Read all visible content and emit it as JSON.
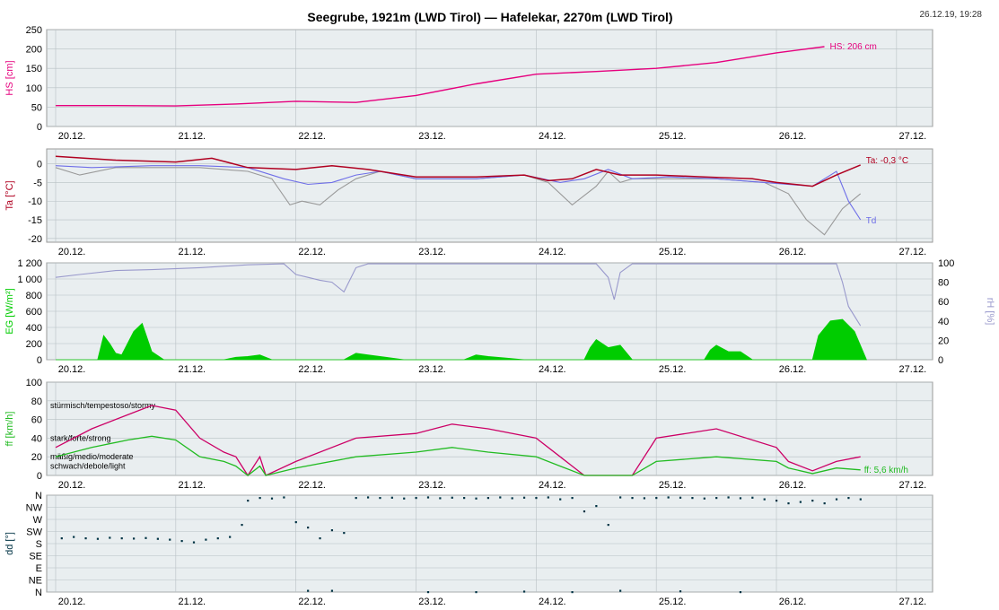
{
  "title": "Seegrube, 1921m (LWD Tirol) — Hafelekar, 2270m (LWD Tirol)",
  "timestamp": "26.12.19, 19:28",
  "colors": {
    "snow": "#e6007e",
    "temp": "#b00020",
    "dew": "#6e6ee8",
    "wetbulb": "#999999",
    "radiation": "#00cc00",
    "humidity": "#9999cc",
    "gust": "#cc0066",
    "wind": "#22bb22",
    "dir": "#003344",
    "panel_bg": "#e9eef0",
    "grid": "#b8c0c4"
  },
  "chart_data": [
    {
      "type": "line",
      "name": "snow-depth",
      "ylabel": "HS [cm]",
      "ylim": [
        0,
        250
      ],
      "yticks": [
        "0",
        "50",
        "100",
        "150",
        "200",
        "250"
      ],
      "x_labels": [
        "20.12.",
        "21.12.",
        "22.12.",
        "23.12.",
        "24.12.",
        "25.12.",
        "26.12.",
        "27.12."
      ],
      "end_label": "HS: 206 cm",
      "series": [
        {
          "name": "HS",
          "x": [
            0,
            0.5,
            1,
            1.5,
            2,
            2.5,
            3,
            3.5,
            4,
            4.5,
            5,
            5.5,
            6,
            6.4
          ],
          "y": [
            54,
            54,
            53,
            58,
            65,
            62,
            80,
            110,
            135,
            142,
            150,
            165,
            190,
            206
          ]
        }
      ]
    },
    {
      "type": "line",
      "name": "air-temperature",
      "ylabel": "Ta [°C]",
      "ylim": [
        -21,
        4
      ],
      "yticks": [
        "0",
        "-5",
        "-10",
        "-15",
        "-20"
      ],
      "x_labels": [
        "20.12.",
        "21.12.",
        "22.12.",
        "23.12.",
        "24.12.",
        "25.12.",
        "26.12.",
        "27.12."
      ],
      "end_label": "Ta: -0,3 °C",
      "dew_label": "Td",
      "series": [
        {
          "name": "Ta",
          "x": [
            0,
            0.5,
            1,
            1.3,
            1.6,
            2,
            2.3,
            2.6,
            3,
            3.5,
            3.9,
            4.1,
            4.3,
            4.5,
            4.7,
            5,
            5.4,
            5.8,
            6,
            6.3,
            6.5,
            6.7
          ],
          "y": [
            2,
            1,
            0.5,
            1.5,
            -1,
            -1.5,
            -0.5,
            -1.5,
            -3.5,
            -3.5,
            -3,
            -4.5,
            -4,
            -1.5,
            -3,
            -3,
            -3.5,
            -4,
            -5,
            -6,
            -3,
            -0.3
          ]
        },
        {
          "name": "Td",
          "x": [
            0,
            0.3,
            0.8,
            1.2,
            1.6,
            1.9,
            2.1,
            2.3,
            2.5,
            2.7,
            3,
            3.5,
            3.9,
            4.2,
            4.4,
            4.6,
            4.8,
            5.1,
            5.5,
            5.9,
            6.3,
            6.5,
            6.6,
            6.7
          ],
          "y": [
            -0.5,
            -1,
            -0.5,
            -0.5,
            -1,
            -4,
            -5.5,
            -5,
            -3,
            -2,
            -4,
            -4,
            -3,
            -5,
            -4,
            -1.5,
            -4,
            -3.5,
            -4,
            -5,
            -6,
            -2,
            -10,
            -15
          ]
        },
        {
          "name": "Tw",
          "x": [
            0,
            0.2,
            0.5,
            0.8,
            1.2,
            1.6,
            1.8,
            1.95,
            2.05,
            2.2,
            2.35,
            2.5,
            2.7,
            3,
            3.5,
            3.9,
            4.1,
            4.3,
            4.5,
            4.6,
            4.7,
            4.8,
            5.1,
            5.5,
            5.9,
            6.1,
            6.25,
            6.4,
            6.55,
            6.7
          ],
          "y": [
            -1,
            -3,
            -1,
            -1,
            -1,
            -2,
            -4,
            -11,
            -10,
            -11,
            -7,
            -4,
            -2,
            -4,
            -4,
            -3,
            -5,
            -11,
            -6,
            -2,
            -5,
            -4,
            -4,
            -4,
            -5,
            -8,
            -15,
            -19,
            -12,
            -8
          ]
        }
      ]
    },
    {
      "type": "area",
      "name": "radiation-humidity",
      "ylabel": "EG [W/m²]",
      "ylabel_right": "rH [%]",
      "ylim": [
        0,
        1200
      ],
      "ylim_right": [
        0,
        100
      ],
      "yticks": [
        "0",
        "200",
        "400",
        "600",
        "800",
        "1 000",
        "1 200"
      ],
      "yticks_right": [
        "0",
        "20",
        "40",
        "60",
        "80",
        "100"
      ],
      "x_labels": [
        "20.12.",
        "21.12.",
        "22.12.",
        "23.12.",
        "24.12.",
        "25.12.",
        "26.12.",
        "27.12."
      ],
      "series": [
        {
          "name": "EG",
          "x": [
            0,
            0.35,
            0.4,
            0.45,
            0.5,
            0.55,
            0.65,
            0.72,
            0.8,
            0.9,
            1,
            1.4,
            1.5,
            1.6,
            1.7,
            1.8,
            2.4,
            2.5,
            2.6,
            2.75,
            2.9,
            3.4,
            3.5,
            3.6,
            3.75,
            3.9,
            4.4,
            4.45,
            4.5,
            4.6,
            4.7,
            4.8,
            5.4,
            5.45,
            5.5,
            5.6,
            5.7,
            5.8,
            6.3,
            6.35,
            6.45,
            6.55,
            6.65,
            6.75
          ],
          "y": [
            0,
            0,
            300,
            200,
            80,
            60,
            350,
            450,
            100,
            0,
            0,
            0,
            30,
            40,
            60,
            0,
            0,
            80,
            60,
            30,
            0,
            0,
            60,
            40,
            20,
            0,
            0,
            150,
            250,
            150,
            180,
            0,
            0,
            120,
            180,
            100,
            100,
            0,
            0,
            300,
            480,
            500,
            350,
            0
          ]
        },
        {
          "name": "rH",
          "x": [
            0,
            0.2,
            0.5,
            0.8,
            1.2,
            1.6,
            1.9,
            2.0,
            2.1,
            2.2,
            2.3,
            2.4,
            2.5,
            2.6,
            2.7,
            3,
            3.5,
            4,
            4.5,
            4.6,
            4.65,
            4.7,
            4.8,
            5,
            5.5,
            6,
            6.3,
            6.5,
            6.55,
            6.6,
            6.7
          ],
          "y": [
            85,
            88,
            92,
            93,
            95,
            98,
            99,
            88,
            85,
            82,
            80,
            70,
            95,
            99,
            99,
            99,
            99,
            99,
            99,
            85,
            62,
            90,
            99,
            99,
            99,
            99,
            99,
            99,
            80,
            55,
            35
          ]
        }
      ]
    },
    {
      "type": "line",
      "name": "wind-speed",
      "ylabel": "ff [km/h]",
      "ylim": [
        0,
        100
      ],
      "yticks": [
        "0",
        "20",
        "40",
        "60",
        "80",
        "100"
      ],
      "x_labels": [
        "20.12.",
        "21.12.",
        "22.12.",
        "23.12.",
        "24.12.",
        "25.12.",
        "26.12.",
        "27.12."
      ],
      "end_label": "ff: 5,6 km/h",
      "annotations": [
        "stürmisch/tempestoso/stormy",
        "stark/forte/strong",
        "mäßig/medio/moderate",
        "schwach/debole/light"
      ],
      "annotation_levels": [
        75,
        40,
        20,
        10
      ],
      "series": [
        {
          "name": "gust",
          "x": [
            0,
            0.3,
            0.6,
            0.8,
            1,
            1.2,
            1.4,
            1.5,
            1.6,
            1.7,
            1.75,
            2,
            2.5,
            3,
            3.3,
            3.6,
            4,
            4.2,
            4.4,
            4.5,
            4.8,
            5,
            5.5,
            6,
            6.1,
            6.3,
            6.5,
            6.7
          ],
          "y": [
            30,
            50,
            65,
            75,
            70,
            40,
            25,
            20,
            0,
            20,
            0,
            15,
            40,
            45,
            55,
            50,
            40,
            20,
            0,
            0,
            0,
            40,
            50,
            30,
            15,
            5,
            15,
            20
          ]
        },
        {
          "name": "wind",
          "x": [
            0,
            0.3,
            0.6,
            0.8,
            1,
            1.2,
            1.4,
            1.5,
            1.6,
            1.7,
            1.75,
            2,
            2.5,
            3,
            3.3,
            3.6,
            4,
            4.2,
            4.4,
            4.5,
            4.8,
            5,
            5.5,
            6,
            6.1,
            6.3,
            6.5,
            6.7
          ],
          "y": [
            20,
            30,
            38,
            42,
            38,
            20,
            15,
            10,
            0,
            10,
            0,
            8,
            20,
            25,
            30,
            25,
            20,
            10,
            0,
            0,
            0,
            15,
            20,
            15,
            8,
            2,
            8,
            6
          ]
        }
      ]
    },
    {
      "type": "scatter",
      "name": "wind-direction",
      "ylabel": "dd [°]",
      "ylim": [
        0,
        360
      ],
      "yticks": [
        "N",
        "NE",
        "E",
        "SE",
        "S",
        "SW",
        "W",
        "NW",
        "N"
      ],
      "x_labels": [
        "20.12.",
        "21.12.",
        "22.12.",
        "23.12.",
        "24.12.",
        "25.12.",
        "26.12.",
        "27.12."
      ],
      "series": [
        {
          "name": "dd",
          "x": [
            0.05,
            0.15,
            0.25,
            0.35,
            0.45,
            0.55,
            0.65,
            0.75,
            0.85,
            0.95,
            1.05,
            1.15,
            1.25,
            1.35,
            1.45,
            1.55,
            1.6,
            1.7,
            1.8,
            1.9,
            2.0,
            2.1,
            2.2,
            2.3,
            2.4,
            2.5,
            2.6,
            2.7,
            2.8,
            2.9,
            3.0,
            3.1,
            3.2,
            3.3,
            3.4,
            3.5,
            3.6,
            3.7,
            3.8,
            3.9,
            4.0,
            4.1,
            4.2,
            4.3,
            4.4,
            4.5,
            4.6,
            4.7,
            4.8,
            4.9,
            5.0,
            5.1,
            5.2,
            5.3,
            5.4,
            5.5,
            5.6,
            5.7,
            5.8,
            5.9,
            6.0,
            6.1,
            6.2,
            6.3,
            6.4,
            6.5,
            6.6,
            6.7,
            2.1,
            2.3,
            3.1,
            3.5,
            3.9,
            4.3,
            4.7,
            5.2,
            5.7
          ],
          "y": [
            200,
            205,
            200,
            198,
            202,
            200,
            199,
            201,
            198,
            195,
            190,
            185,
            195,
            200,
            205,
            250,
            340,
            350,
            348,
            352,
            260,
            240,
            200,
            230,
            220,
            350,
            352,
            350,
            351,
            348,
            350,
            352,
            349,
            351,
            350,
            348,
            350,
            352,
            349,
            351,
            350,
            352,
            345,
            350,
            300,
            320,
            250,
            352,
            350,
            349,
            350,
            352,
            351,
            350,
            348,
            350,
            352,
            349,
            351,
            345,
            340,
            330,
            335,
            340,
            330,
            345,
            350,
            345,
            5,
            5,
            0,
            0,
            2,
            0,
            5,
            3,
            0
          ]
        }
      ]
    }
  ]
}
